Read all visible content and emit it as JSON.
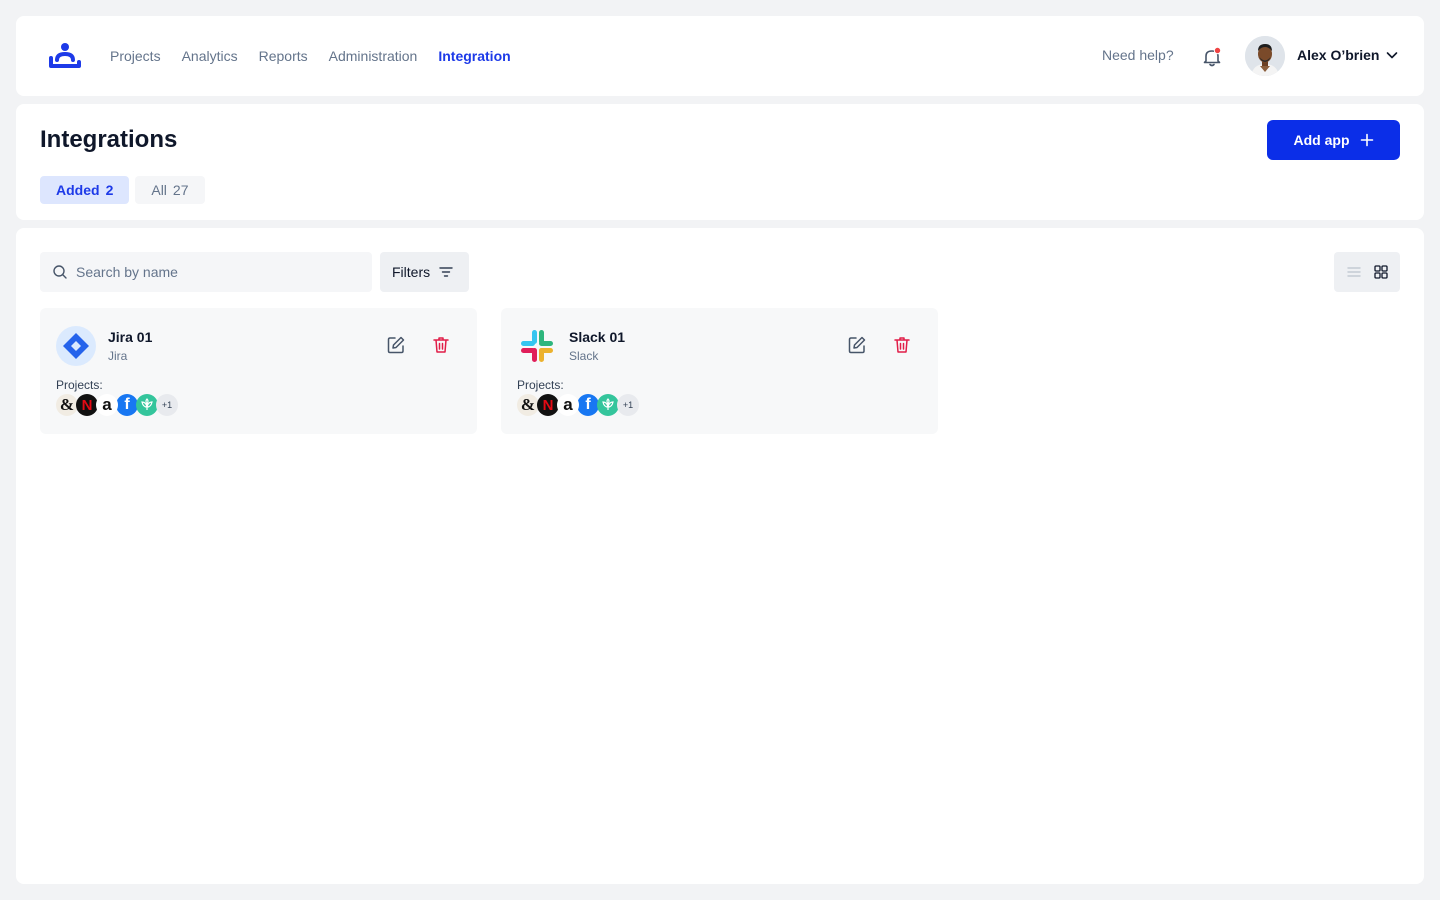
{
  "nav": {
    "items": [
      "Projects",
      "Analytics",
      "Reports",
      "Administration",
      "Integration"
    ],
    "active": "Integration",
    "help": "Need help?",
    "user_name": "Alex O’brien"
  },
  "header": {
    "title": "Integrations",
    "add_button": "Add app",
    "tabs": [
      {
        "label": "Added",
        "count": "2"
      },
      {
        "label": "All",
        "count": "27"
      }
    ]
  },
  "toolbar": {
    "search_placeholder": "Search by name",
    "filters_label": "Filters"
  },
  "integrations": [
    {
      "name": "Jira 01",
      "app": "Jira",
      "projects_label": "Projects:",
      "more": "+1"
    },
    {
      "name": "Slack 01",
      "app": "Slack",
      "projects_label": "Projects:",
      "more": "+1"
    }
  ],
  "colors": {
    "accent": "#1d3ae8",
    "primary_button": "#0b2ee8",
    "delete": "#e11d48",
    "notification_dot": "#ef4444"
  },
  "icons": {
    "logo": "brand-logo",
    "bell": "bell-icon",
    "search": "search-icon",
    "filters": "filter-icon",
    "list_view": "list-view-icon",
    "grid_view": "grid-view-icon",
    "edit": "edit-icon",
    "delete": "trash-icon"
  }
}
